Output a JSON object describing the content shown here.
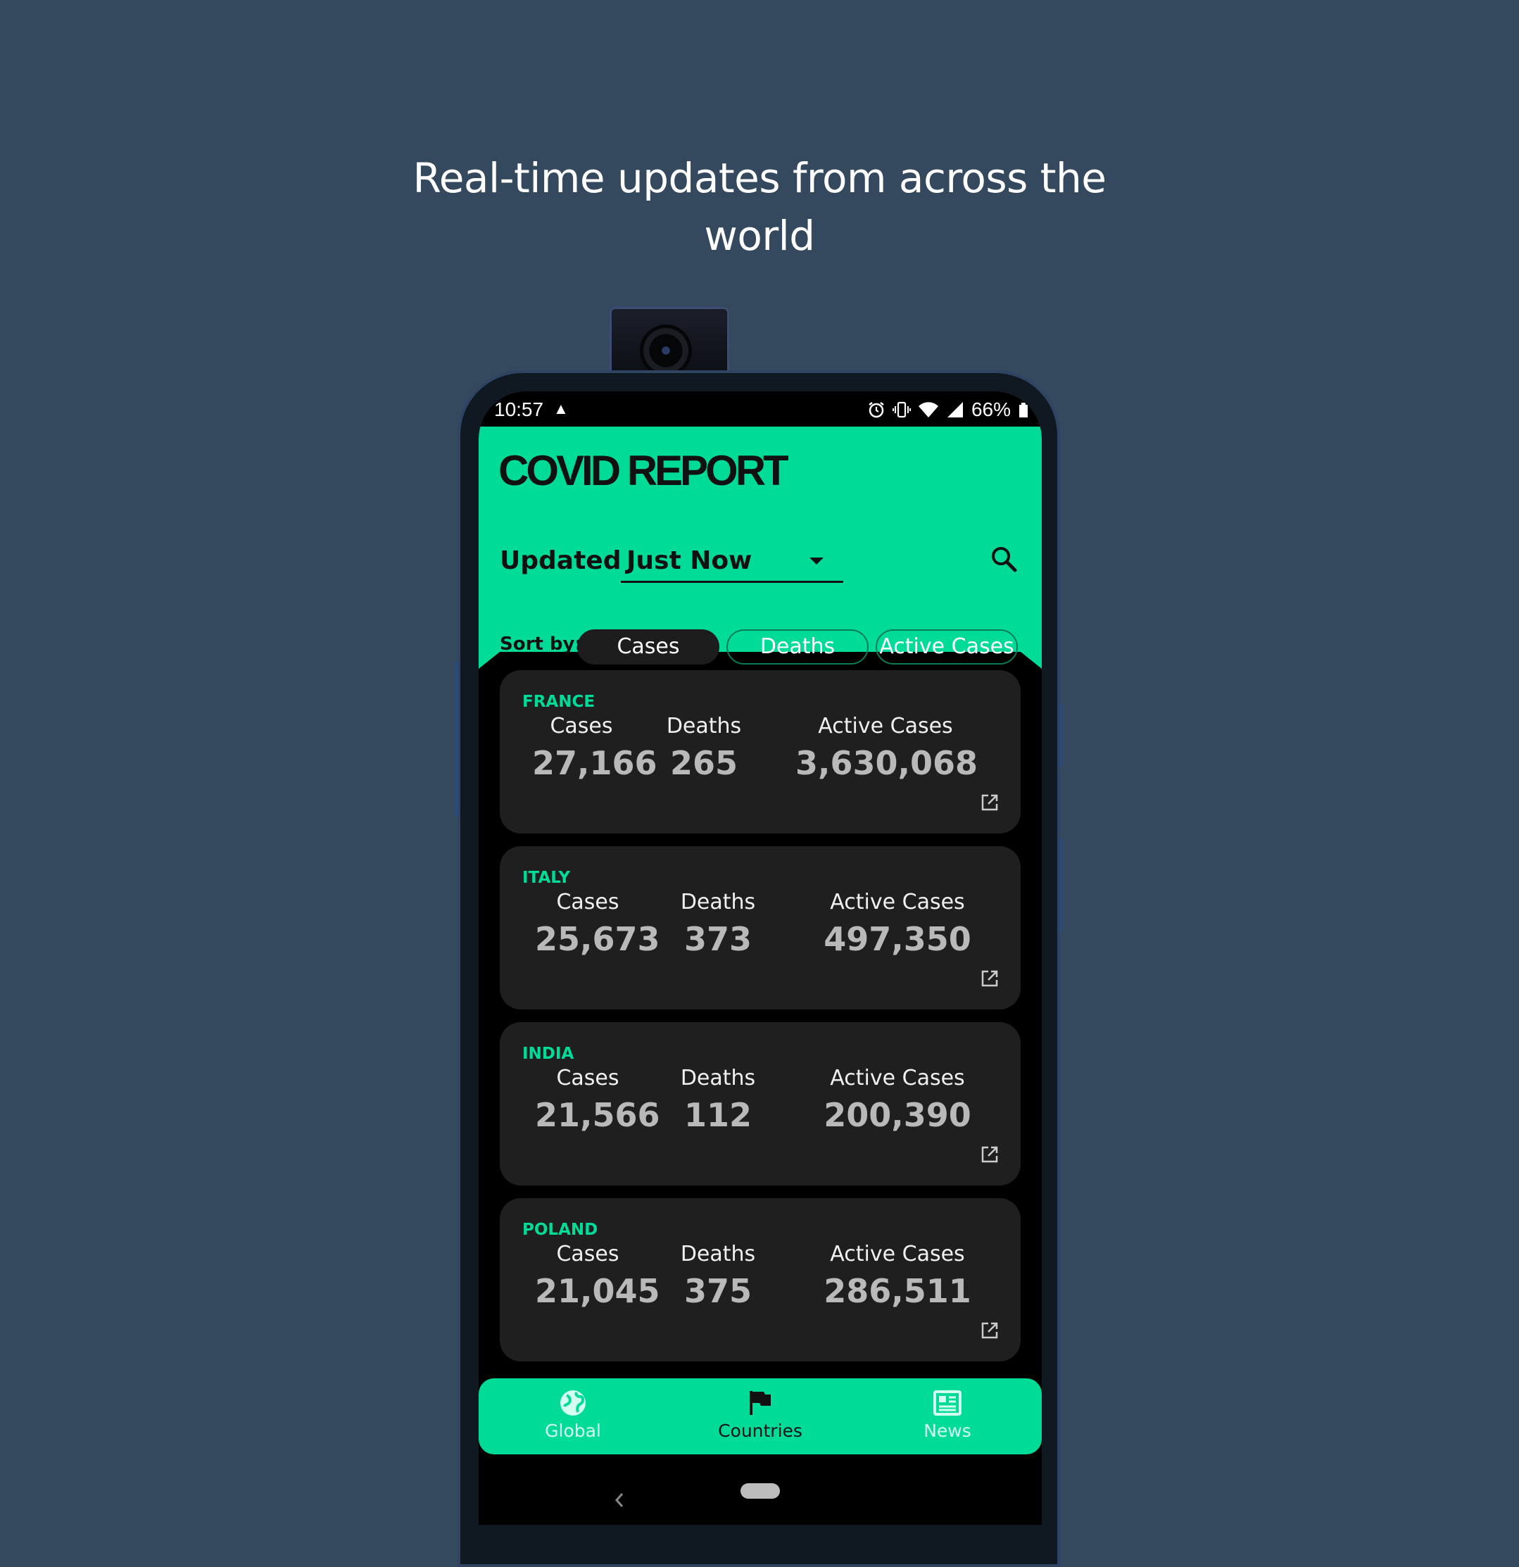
{
  "headline": {
    "line1": "Real-time updates from across the",
    "line2": "world"
  },
  "status_bar": {
    "time": "10:57",
    "battery": "66%",
    "icons": [
      "notification-icon",
      "alarm-icon",
      "vibrate-icon",
      "wifi-icon",
      "signal-icon",
      "battery-icon"
    ]
  },
  "app": {
    "title": "COVID REPORT"
  },
  "updated": {
    "label": "Updated",
    "value": "Just Now"
  },
  "sort": {
    "label": "Sort by:",
    "options": [
      {
        "label": "Cases",
        "selected": true
      },
      {
        "label": "Deaths",
        "selected": false
      },
      {
        "label": "Active Cases",
        "selected": false
      }
    ]
  },
  "countries": [
    {
      "name": "FRANCE",
      "cases_label": "Cases",
      "cases": "27,166",
      "deaths_label": "Deaths",
      "deaths": "265",
      "active_label": "Active Cases",
      "active": "3,630,068"
    },
    {
      "name": "ITALY",
      "cases_label": "Cases",
      "cases": "25,673",
      "deaths_label": "Deaths",
      "deaths": "373",
      "active_label": "Active Cases",
      "active": "497,350"
    },
    {
      "name": "INDIA",
      "cases_label": "Cases",
      "cases": "21,566",
      "deaths_label": "Deaths",
      "deaths": "112",
      "active_label": "Active Cases",
      "active": "200,390"
    },
    {
      "name": "POLAND",
      "cases_label": "Cases",
      "cases": "21,045",
      "deaths_label": "Deaths",
      "deaths": "375",
      "active_label": "Active Cases",
      "active": "286,511"
    }
  ],
  "bottom_nav": [
    {
      "label": "Global",
      "icon": "globe-icon",
      "selected": false
    },
    {
      "label": "Countries",
      "icon": "flag-icon",
      "selected": true
    },
    {
      "label": "News",
      "icon": "news-icon",
      "selected": false
    }
  ],
  "colors": {
    "accent": "#00dc98",
    "background": "#34495e",
    "card": "#1f1f1f"
  }
}
